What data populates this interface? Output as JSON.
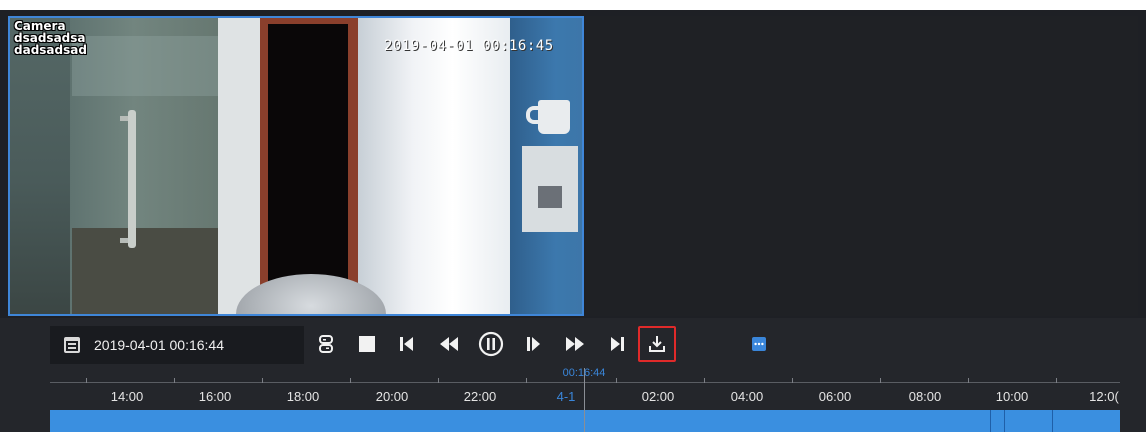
{
  "video": {
    "osd_name_lines": [
      "Camera",
      "dsadsadsa",
      "dadsadsad"
    ],
    "osd_timestamp": "2019-04-01  00:16:45"
  },
  "controls": {
    "current_datetime": "2019-04-01 00:16:44",
    "icons": [
      "calendar-icon",
      "split-screen-icon",
      "stop-icon",
      "previous-frame-icon",
      "rewind-icon",
      "pause-icon",
      "step-forward-icon",
      "fast-forward-icon",
      "next-frame-icon",
      "download-icon",
      "more-icon"
    ],
    "highlight_color": "#e02a2a"
  },
  "timeline": {
    "cursor_time": "00:16:44",
    "labels": [
      "14:00",
      "16:00",
      "18:00",
      "20:00",
      "22:00",
      "4-1",
      "02:00",
      "04:00",
      "06:00",
      "08:00",
      "10:00",
      "12:0("
    ],
    "record_color": "#3a8fe0",
    "accent_color": "#3a86da"
  }
}
